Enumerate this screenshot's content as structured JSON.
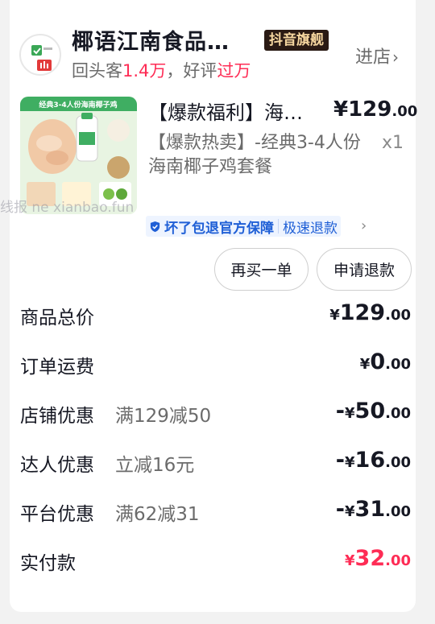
{
  "shop": {
    "name": "椰语江南食品…",
    "badge": "抖音旗舰",
    "stats_prefix": "回头客",
    "repeat_count": "1.4万",
    "stats_sep": "，好评",
    "good_review": "过万",
    "enter_label": "进店"
  },
  "product": {
    "title": "【爆款福利】海…",
    "price_int": "¥129",
    "price_dec": ".00",
    "subtitle": "【爆款热卖】-经典3-4人份海南椰子鸡套餐",
    "qty": "x1",
    "image_text": "经典3-4人份海南椰子鸡"
  },
  "guarantee": {
    "item1": "坏了包退官方保障",
    "item2": "极速退款"
  },
  "actions": {
    "rebuy": "再买一单",
    "refund": "申请退款"
  },
  "watermark": "线报  ne  xianbao.fun",
  "price_rows": [
    {
      "label": "商品总价",
      "note": "",
      "prefix": "",
      "cur": "¥",
      "int": "129",
      "dec": ".00"
    },
    {
      "label": "订单运费",
      "note": "",
      "prefix": "",
      "cur": "¥",
      "int": "0",
      "dec": ".00"
    },
    {
      "label": "店铺优惠",
      "note": "满129减50",
      "prefix": "-",
      "cur": "¥",
      "int": "50",
      "dec": ".00"
    },
    {
      "label": "达人优惠",
      "note": "立减16元",
      "prefix": "-",
      "cur": "¥",
      "int": "16",
      "dec": ".00"
    },
    {
      "label": "平台优惠",
      "note": "满62减31",
      "prefix": "-",
      "cur": "¥",
      "int": "31",
      "dec": ".00"
    },
    {
      "label": "实付款",
      "note": "",
      "prefix": "",
      "cur": "¥",
      "int": "32",
      "dec": ".00"
    }
  ],
  "colors": {
    "accent": "#fe2c55",
    "badge_bg": "#2a1a14",
    "badge_text": "#f6d7a0",
    "guarantee_blue": "#1f5fd6"
  }
}
